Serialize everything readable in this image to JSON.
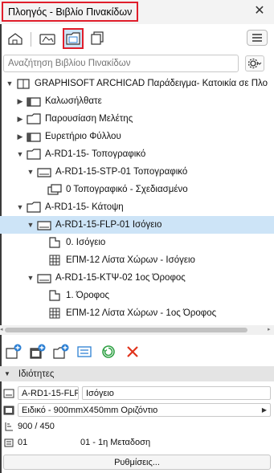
{
  "window": {
    "title": "Πλοηγός - Βιβλίο Πινακίδων",
    "close_label": "✕"
  },
  "toolbar": {
    "buttons": [
      {
        "icon": "project-map-icon",
        "active": false
      },
      {
        "icon": "view-map-icon",
        "active": false
      },
      {
        "icon": "layout-book-icon",
        "active": true
      },
      {
        "icon": "publisher-sets-icon",
        "active": false
      }
    ],
    "menu_icon": "hamburger-menu-icon"
  },
  "search": {
    "placeholder": "Αναζήτηση Βιβλίου Πινακίδων",
    "value": ""
  },
  "tree": [
    {
      "depth": 0,
      "arrow": "expanded",
      "icon": "book-root",
      "label": "GRAPHISOFT ARCHICAD Παράδειγμα- Κατοικία σε Πλο",
      "selected": false
    },
    {
      "depth": 1,
      "arrow": "collapsed",
      "icon": "master",
      "label": "Καλωσήλθατε",
      "selected": false
    },
    {
      "depth": 1,
      "arrow": "collapsed",
      "icon": "folder",
      "label": "Παρουσίαση Μελέτης",
      "selected": false
    },
    {
      "depth": 1,
      "arrow": "collapsed",
      "icon": "master",
      "label": "Ευρετήριο Φύλλου",
      "selected": false
    },
    {
      "depth": 1,
      "arrow": "expanded",
      "icon": "folder",
      "label": "A-RD1-15- Τοπογραφικό",
      "selected": false
    },
    {
      "depth": 2,
      "arrow": "expanded",
      "icon": "layout",
      "label": "A-RD1-15-STP-01 Τοπογραφικό",
      "selected": false
    },
    {
      "depth": 3,
      "arrow": "none",
      "icon": "drawing",
      "label": "0 Τοπογραφικό - Σχεδιασμένο",
      "selected": false
    },
    {
      "depth": 1,
      "arrow": "expanded",
      "icon": "folder",
      "label": "A-RD1-15- Κάτοψη",
      "selected": false
    },
    {
      "depth": 2,
      "arrow": "expanded",
      "icon": "layout",
      "label": "A-RD1-15-FLP-01 Ισόγειο",
      "selected": true
    },
    {
      "depth": 3,
      "arrow": "none",
      "icon": "plan-view",
      "label": "0. Ισόγειο",
      "selected": false
    },
    {
      "depth": 3,
      "arrow": "none",
      "icon": "table",
      "label": "ΕΠΜ-12 Λίστα Χώρων - Ισόγειο",
      "selected": false
    },
    {
      "depth": 2,
      "arrow": "expanded",
      "icon": "layout",
      "label": "A-RD1-15-ΚΤΨ-02 1ος Όροφος",
      "selected": false
    },
    {
      "depth": 3,
      "arrow": "none",
      "icon": "plan-view",
      "label": "1. Όροφος",
      "selected": false
    },
    {
      "depth": 3,
      "arrow": "none",
      "icon": "table",
      "label": "ΕΠΜ-12 Λίστα Χώρων - 1ος Όροφος",
      "selected": false
    }
  ],
  "actions": [
    {
      "name": "new-layout-button",
      "icon": "new-layout-icon"
    },
    {
      "name": "new-master-button",
      "icon": "new-master-icon"
    },
    {
      "name": "new-subset-button",
      "icon": "new-subset-icon"
    },
    {
      "name": "layout-list-button",
      "icon": "list-icon"
    },
    {
      "name": "update-button",
      "icon": "refresh-icon"
    },
    {
      "name": "delete-button",
      "icon": "delete-icon"
    }
  ],
  "properties": {
    "header": "Ιδιότητες",
    "id_value": "A-RD1-15-FLP",
    "name_value": "Ισόγειο",
    "master_value": "Ειδικό - 900mmX450mm Οριζόντιο",
    "size_value": "900 / 450",
    "revision_id": "01",
    "revision_label": "01 - 1η Μεταδοση",
    "settings_label": "Ρυθμίσεις..."
  },
  "colors": {
    "highlight": "#e01e2b",
    "selection": "#cde4f7",
    "icon_blue": "#2b7fd3",
    "refresh_green": "#2ea043",
    "delete_red": "#e0331b"
  }
}
